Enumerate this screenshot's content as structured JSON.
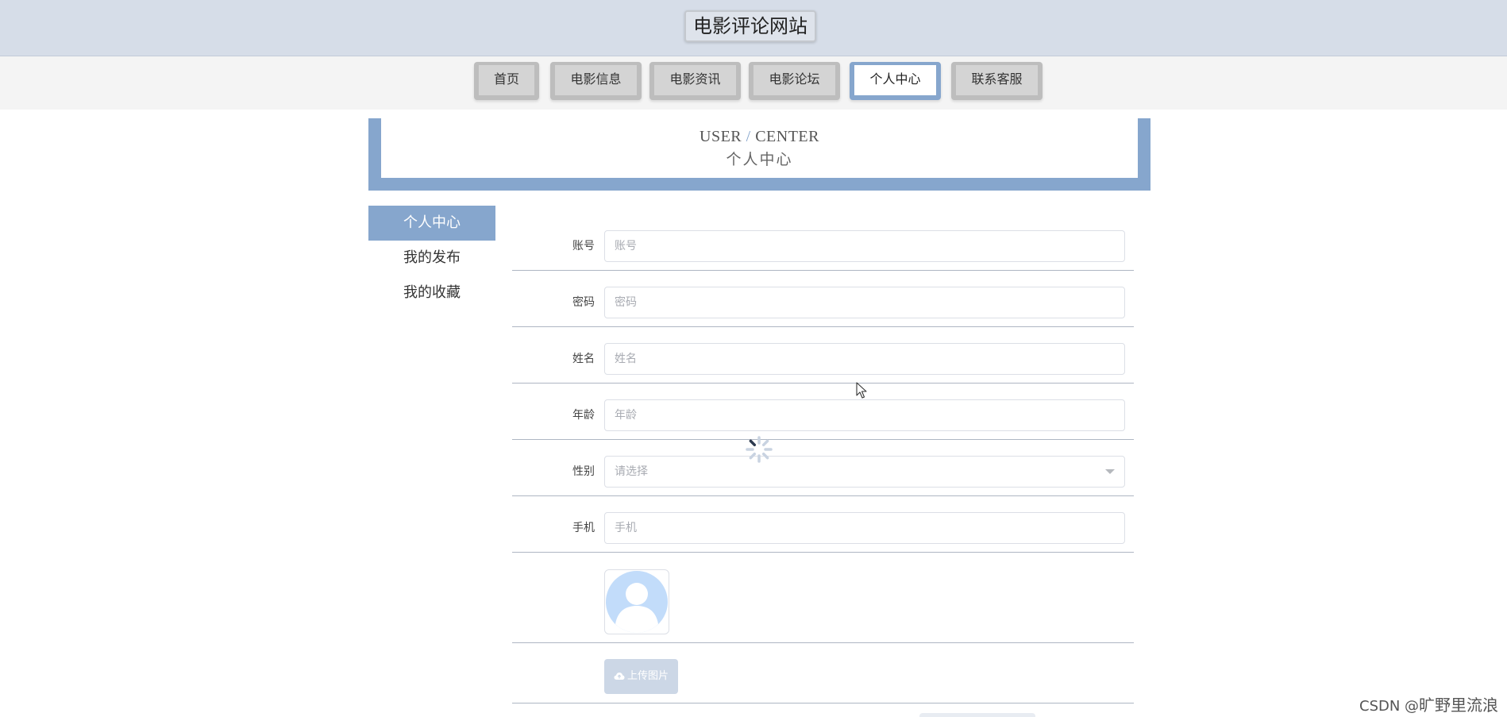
{
  "header": {
    "site_title": "电影评论网站"
  },
  "nav": {
    "items": [
      {
        "label": "首页"
      },
      {
        "label": "电影信息"
      },
      {
        "label": "电影资讯"
      },
      {
        "label": "电影论坛"
      },
      {
        "label": "个人中心",
        "active": true
      },
      {
        "label": "联系客服"
      }
    ]
  },
  "banner": {
    "title_en_left": "USER",
    "title_en_sep": "/",
    "title_en_right": "CENTER",
    "title_cn": "个人中心"
  },
  "side_menu": {
    "items": [
      {
        "label": "个人中心",
        "active": true
      },
      {
        "label": "我的发布"
      },
      {
        "label": "我的收藏"
      }
    ]
  },
  "form": {
    "account": {
      "label": "账号",
      "placeholder": "账号",
      "value": ""
    },
    "password": {
      "label": "密码",
      "placeholder": "密码",
      "value": ""
    },
    "name": {
      "label": "姓名",
      "placeholder": "姓名",
      "value": ""
    },
    "age": {
      "label": "年龄",
      "placeholder": "年龄",
      "value": ""
    },
    "gender": {
      "label": "性别",
      "placeholder": "请选择",
      "value": ""
    },
    "phone": {
      "label": "手机",
      "placeholder": "手机",
      "value": ""
    },
    "avatar_icon": "user-avatar-placeholder",
    "upload_label": "上传图片",
    "upload_icon": "upload-cloud-icon"
  },
  "watermark": {
    "prefix": "CSDN @",
    "name": "旷野里流浪"
  },
  "colors": {
    "accent": "#86a6cd",
    "topbar_bg": "#d6dde8",
    "nav_bg": "#f4f4f4",
    "nav_tab": "#d4d4d4",
    "avatar_blue": "#c2dcfa"
  }
}
